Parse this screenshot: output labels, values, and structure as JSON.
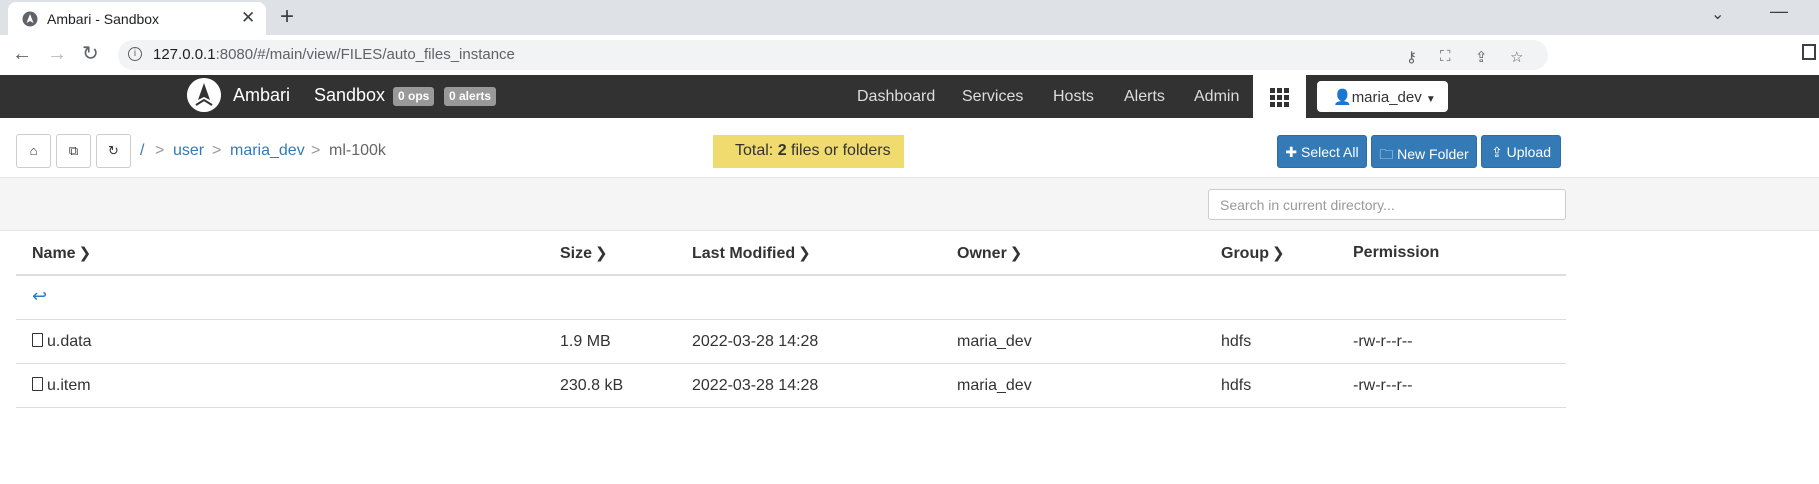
{
  "browser": {
    "tab_title": "Ambari - Sandbox",
    "url_host": "127.0.0.1",
    "url_path": ":8080/#/main/view/FILES/auto_files_instance"
  },
  "header": {
    "brand": "Ambari",
    "cluster": "Sandbox",
    "ops_badge": "0 ops",
    "alerts_badge": "0 alerts",
    "nav": [
      "Dashboard",
      "Services",
      "Hosts",
      "Alerts",
      "Admin"
    ],
    "user": "maria_dev"
  },
  "files": {
    "breadcrumb": {
      "root": "/",
      "separator": ">",
      "items": [
        "user",
        "maria_dev"
      ],
      "current": "ml-100k"
    },
    "total_prefix": "Total: ",
    "total_count": "2",
    "total_suffix": " files or folders",
    "buttons": {
      "select_all": "Select All",
      "new_folder": "New Folder",
      "upload": "Upload"
    },
    "search_placeholder": "Search in current directory...",
    "columns": {
      "name": "Name",
      "size": "Size",
      "last_modified": "Last Modified",
      "owner": "Owner",
      "group": "Group",
      "permission": "Permission"
    },
    "rows": [
      {
        "name": "u.data",
        "size": "1.9 MB",
        "modified": "2022-03-28 14:28",
        "owner": "maria_dev",
        "group": "hdfs",
        "permission": "-rw-r--r--"
      },
      {
        "name": "u.item",
        "size": "230.8 kB",
        "modified": "2022-03-28 14:28",
        "owner": "maria_dev",
        "group": "hdfs",
        "permission": "-rw-r--r--"
      }
    ]
  },
  "colors": {
    "header_bg": "#323232",
    "accent_blue": "#337ab7",
    "total_bg": "#f0db6e"
  }
}
